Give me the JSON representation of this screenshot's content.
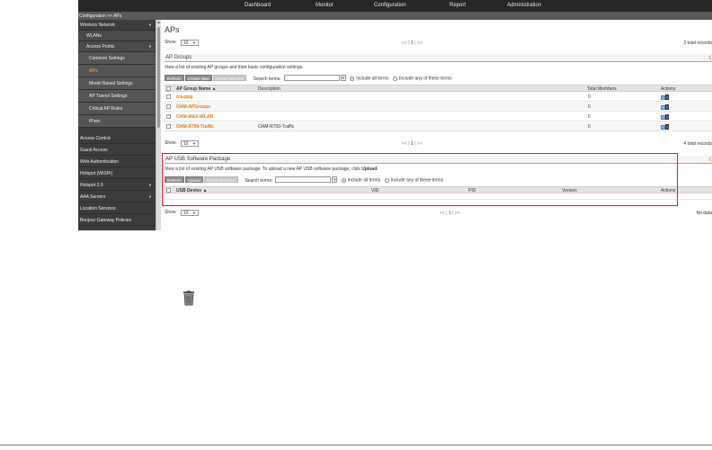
{
  "nav": {
    "items": [
      "Dashboard",
      "Monitor",
      "Configuration",
      "Report",
      "Administration"
    ]
  },
  "breadcrumb": "Configuration >> APs",
  "sidebar": {
    "items": [
      {
        "label": "Wireless Network",
        "level": 0,
        "arrow": "▼"
      },
      {
        "label": "WLANs",
        "level": 1
      },
      {
        "label": "Access Points",
        "level": 1,
        "arrow": "▼"
      },
      {
        "label": "Common Settings",
        "level": 2
      },
      {
        "label": "APs",
        "level": 2,
        "active": true
      },
      {
        "label": "Model Based Settings",
        "level": 2
      },
      {
        "label": "AP Tunnel Settings",
        "level": 2
      },
      {
        "label": "Critical AP Rules",
        "level": 2
      },
      {
        "label": "IPsec",
        "level": 2
      },
      {
        "label": "Access Control",
        "level": 0
      },
      {
        "label": "Guest Access",
        "level": 0
      },
      {
        "label": "Web Authentication",
        "level": 0
      },
      {
        "label": "Hotspot (WISPr)",
        "level": 0
      },
      {
        "label": "Hotspot 2.0",
        "level": 0,
        "arrow": "▼"
      },
      {
        "label": "AAA Servers",
        "level": 0,
        "arrow": "▼"
      },
      {
        "label": "Location Services",
        "level": 0
      },
      {
        "label": "Bonjour Gateway Policies",
        "level": 0
      }
    ]
  },
  "page": {
    "title": "APs",
    "show_label": "Show",
    "show_value": "10",
    "pager": {
      "prev": "<< |",
      "current": "1",
      "next": "| >>"
    },
    "total": "2 total records"
  },
  "ap_groups": {
    "title": "AP Groups",
    "description": "View a list of existing AP groups and their basic configuration settings.",
    "buttons": {
      "refresh": "Refresh",
      "create": "Create New",
      "delete": "Delete Selected"
    },
    "search_label": "Search terms:",
    "search_value": "",
    "include_all": "Include all terms",
    "include_any": "Include any of these terms",
    "columns": {
      "name": "AP Group Name ▲",
      "description": "Description",
      "members": "Total Members",
      "actions": "Actions"
    },
    "rows": [
      {
        "name": "rca-ppg",
        "description": "",
        "members": "0"
      },
      {
        "name": "OAM-APGroups",
        "description": "",
        "members": "0"
      },
      {
        "name": "OAM-MAX-WLAN",
        "description": "",
        "members": "0"
      },
      {
        "name": "OAM-R700-Traffic",
        "description": "OAM-R700-Traffic",
        "members": "0"
      }
    ],
    "show_label": "Show",
    "show_value": "10",
    "pager": {
      "prev": "<< |",
      "current": "1",
      "next": "| >>"
    },
    "total": "4 total records"
  },
  "usb": {
    "title": "AP USB Software Package",
    "description_prefix": "View a list of existing AP USB software package. To upload a new AP USB software package, click ",
    "description_link": "Upload",
    "description_suffix": ".",
    "buttons": {
      "refresh": "Refresh",
      "upload": "Upload",
      "delete": "Delete Selected"
    },
    "search_label": "Search terms:",
    "search_value": "",
    "include_all": "Include all terms",
    "include_any": "Include any of these terms",
    "columns": {
      "device": "USB Device ▲",
      "vid": "VID",
      "pid": "PID",
      "version": "Version",
      "actions": "Actions"
    },
    "show_label": "Show",
    "show_value": "10",
    "pager": {
      "prev": "<< |",
      "current": "1",
      "next": "| >>"
    },
    "total": "No data"
  },
  "colors": {
    "accent": "#e07a12",
    "highlight_box": "#e0162b",
    "nav_bg": "#262626",
    "sidebar_bg": "#3c3c3c"
  },
  "icons": {
    "trash": "trash-icon",
    "edit": "edit-icon",
    "delete": "delete-icon"
  }
}
